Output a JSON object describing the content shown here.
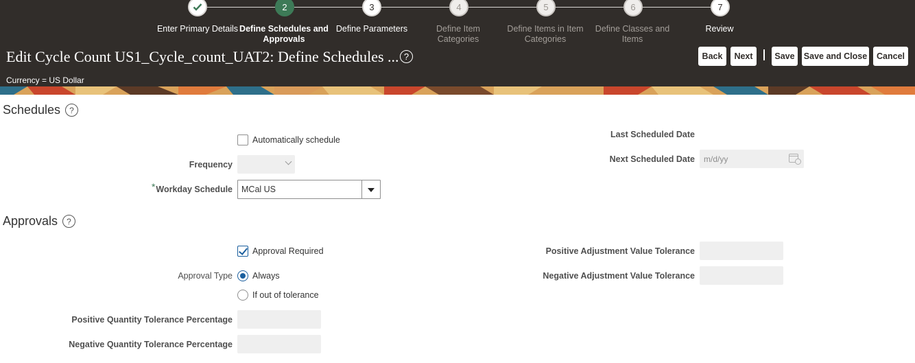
{
  "train": {
    "steps": [
      {
        "number": "",
        "label": "Enter Primary Details",
        "state": "done"
      },
      {
        "number": "2",
        "label": "Define Schedules and Approvals",
        "state": "current"
      },
      {
        "number": "3",
        "label": "Define Parameters",
        "state": "enabled"
      },
      {
        "number": "4",
        "label": "Define Item Categories",
        "state": "disabled"
      },
      {
        "number": "5",
        "label": "Define Items in Item Categories",
        "state": "disabled"
      },
      {
        "number": "6",
        "label": "Define Classes and Items",
        "state": "disabled"
      },
      {
        "number": "7",
        "label": "Review",
        "state": "enabled"
      }
    ]
  },
  "header": {
    "title": "Edit Cycle Count US1_Cycle_count_UAT2: Define Schedules ...",
    "currency": "Currency = US Dollar",
    "help_icon": "question-circle-icon"
  },
  "buttons": {
    "back": "Back",
    "next": "Next",
    "save": "Save",
    "save_and_close": "Save and Close",
    "cancel": "Cancel"
  },
  "schedules": {
    "title": "Schedules",
    "auto_schedule_label": "Automatically schedule",
    "auto_schedule_checked": false,
    "frequency_label": "Frequency",
    "frequency_value": "",
    "workday_schedule_label": "Workday Schedule",
    "workday_schedule_required": "*",
    "workday_schedule_value": "MCal US",
    "last_scheduled_date_label": "Last Scheduled Date",
    "last_scheduled_date_value": "",
    "next_scheduled_date_label": "Next Scheduled Date",
    "next_scheduled_date_placeholder": "m/d/yy"
  },
  "approvals": {
    "title": "Approvals",
    "approval_required_label": "Approval Required",
    "approval_required_checked": true,
    "approval_type_label": "Approval Type",
    "approval_type_options": [
      "Always",
      "If out of tolerance"
    ],
    "approval_type_selected": "Always",
    "positive_qty_tolerance_label": "Positive Quantity Tolerance Percentage",
    "negative_qty_tolerance_label": "Negative Quantity Tolerance Percentage",
    "positive_adj_value_tolerance_label": "Positive Adjustment Value Tolerance",
    "negative_adj_value_tolerance_label": "Negative Adjustment Value Tolerance"
  },
  "colors": {
    "header_bg": "#312d2a",
    "current_step": "#3d7a57",
    "control_accent": "#1b5f9e"
  }
}
